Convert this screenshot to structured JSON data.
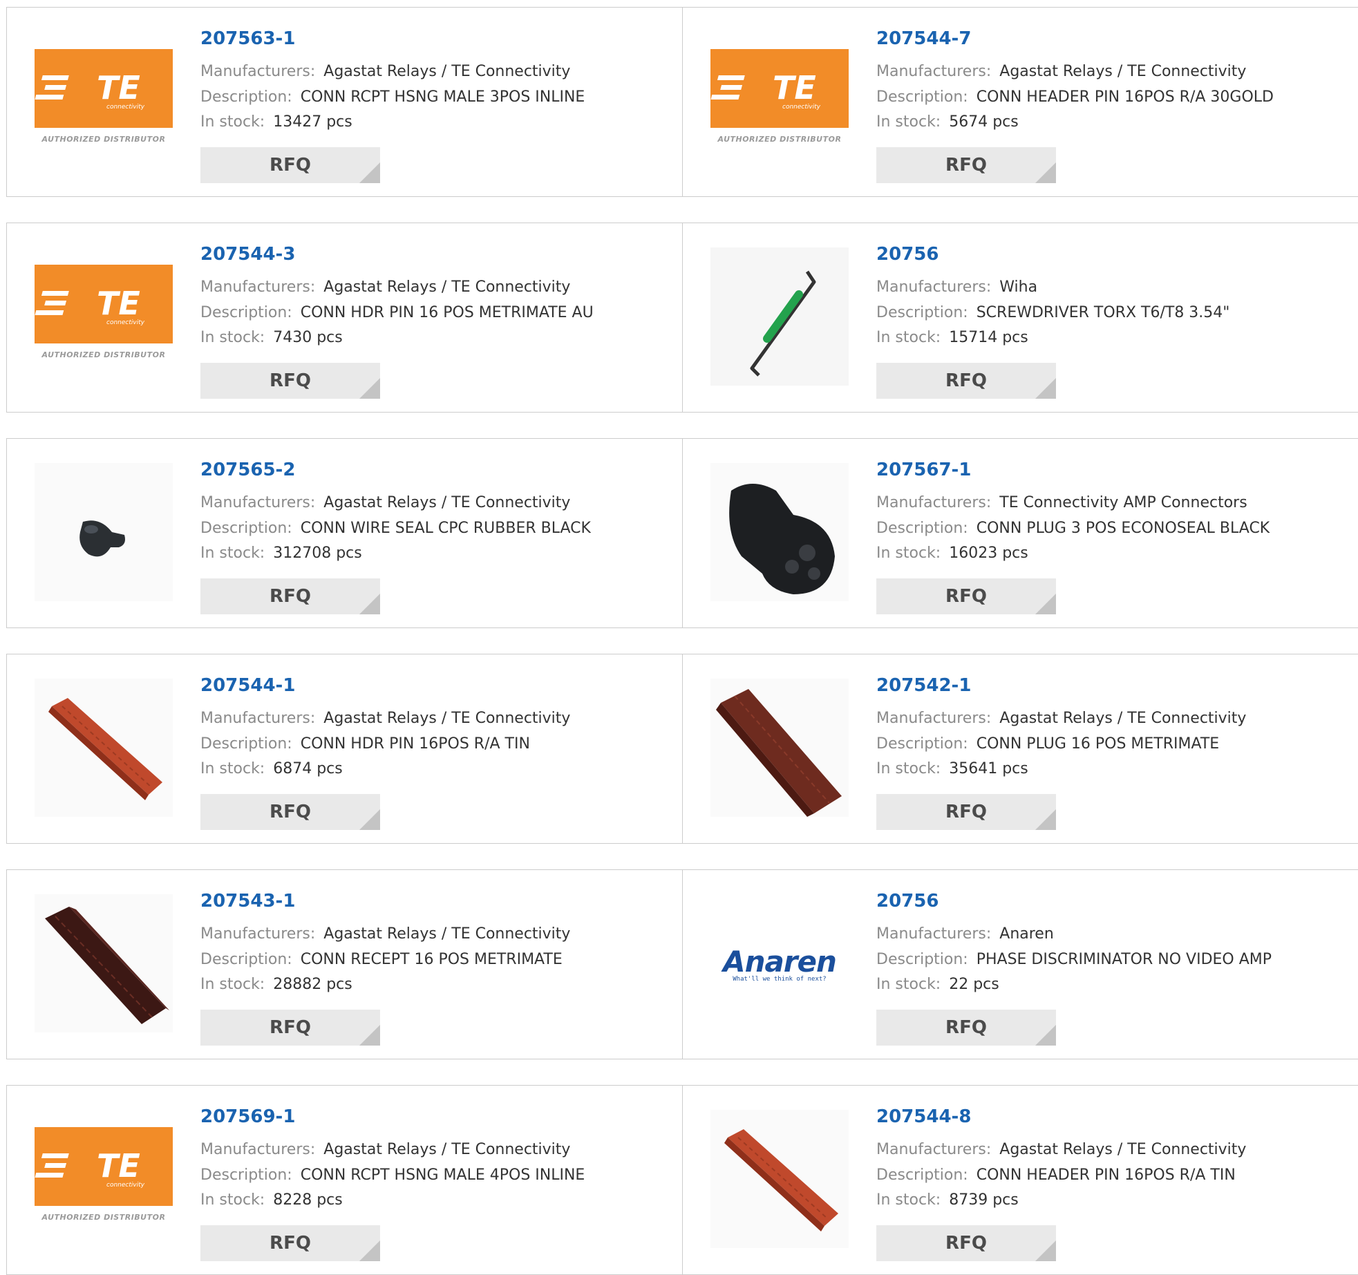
{
  "labels": {
    "manufacturers": "Manufacturers:",
    "description": "Description:",
    "in_stock": "In stock:",
    "rfq": "RFQ"
  },
  "logos": {
    "te_authorized": "AUTHORIZED DISTRIBUTOR",
    "te_word": "TE",
    "te_sub": "connectivity",
    "anaren_word": "Anaren",
    "anaren_tag": "What'll we think of next?"
  },
  "colors": {
    "part_link": "#1a63b0",
    "te_orange": "#f28c28",
    "button_bg": "#e9e9e9",
    "border": "#cccccc"
  },
  "products": [
    {
      "part": "207563-1",
      "manufacturer": "Agastat Relays / TE Connectivity",
      "description": "CONN RCPT HSNG MALE 3POS INLINE",
      "stock": "13427 pcs",
      "image": "te-logo"
    },
    {
      "part": "207544-7",
      "manufacturer": "Agastat Relays / TE Connectivity",
      "description": "CONN HEADER PIN 16POS R/A 30GOLD",
      "stock": "5674 pcs",
      "image": "te-logo"
    },
    {
      "part": "207544-3",
      "manufacturer": "Agastat Relays / TE Connectivity",
      "description": "CONN HDR PIN 16 POS METRIMATE AU",
      "stock": "7430 pcs",
      "image": "te-logo"
    },
    {
      "part": "20756",
      "manufacturer": "Wiha",
      "description": "SCREWDRIVER TORX T6/T8 3.54\"",
      "stock": "15714 pcs",
      "image": "screwdriver"
    },
    {
      "part": "207565-2",
      "manufacturer": "Agastat Relays / TE Connectivity",
      "description": "CONN WIRE SEAL CPC RUBBER BLACK",
      "stock": "312708 pcs",
      "image": "wire-seal"
    },
    {
      "part": "207567-1",
      "manufacturer": "TE Connectivity AMP Connectors",
      "description": "CONN PLUG 3 POS ECONOSEAL BLACK",
      "stock": "16023 pcs",
      "image": "plug"
    },
    {
      "part": "207544-1",
      "manufacturer": "Agastat Relays / TE Connectivity",
      "description": "CONN HDR PIN 16POS R/A TIN",
      "stock": "6874 pcs",
      "image": "red-header"
    },
    {
      "part": "207542-1",
      "manufacturer": "Agastat Relays / TE Connectivity",
      "description": "CONN PLUG 16 POS METRIMATE",
      "stock": "35641 pcs",
      "image": "brown-plug"
    },
    {
      "part": "207543-1",
      "manufacturer": "Agastat Relays / TE Connectivity",
      "description": "CONN RECEPT 16 POS METRIMATE",
      "stock": "28882 pcs",
      "image": "dark-recept"
    },
    {
      "part": "20756",
      "manufacturer": "Anaren",
      "description": "PHASE DISCRIMINATOR NO VIDEO AMP",
      "stock": "22 pcs",
      "image": "anaren-logo"
    },
    {
      "part": "207569-1",
      "manufacturer": "Agastat Relays / TE Connectivity",
      "description": "CONN RCPT HSNG MALE 4POS INLINE",
      "stock": "8228 pcs",
      "image": "te-logo"
    },
    {
      "part": "207544-8",
      "manufacturer": "Agastat Relays / TE Connectivity",
      "description": "CONN HEADER PIN 16POS R/A TIN",
      "stock": "8739 pcs",
      "image": "red-header"
    }
  ]
}
